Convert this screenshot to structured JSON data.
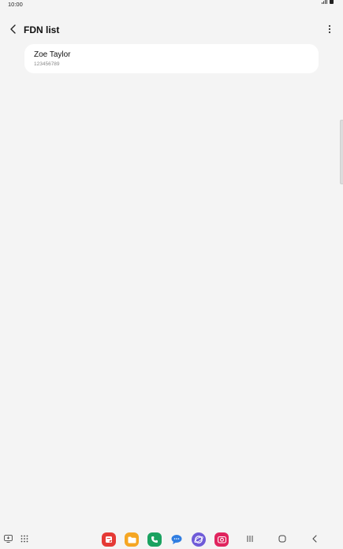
{
  "status_bar": {
    "time": "10:00",
    "icons": [
      "signal-icon",
      "battery-icon"
    ]
  },
  "app_bar": {
    "back_icon": "back-arrow-icon",
    "title": "FDN list",
    "more_icon": "more-options-icon"
  },
  "contacts": [
    {
      "name": "Zoe Taylor",
      "number": "123456789"
    }
  ],
  "nav_bar": {
    "left_icons": [
      "screenshot-icon",
      "apps-grid-icon"
    ],
    "dock_apps": [
      {
        "name": "notes-app-icon",
        "color": "#e53935"
      },
      {
        "name": "my-files-app-icon",
        "color": "#f5a623"
      },
      {
        "name": "phone-app-icon",
        "color": "#1aa260"
      },
      {
        "name": "messages-app-icon",
        "color": "#2f7de1"
      },
      {
        "name": "internet-app-icon",
        "color": "#6f5bd8"
      },
      {
        "name": "camera-app-icon",
        "color": "#e0245e"
      }
    ],
    "system_buttons": [
      "recents-button",
      "home-button",
      "back-button"
    ]
  }
}
